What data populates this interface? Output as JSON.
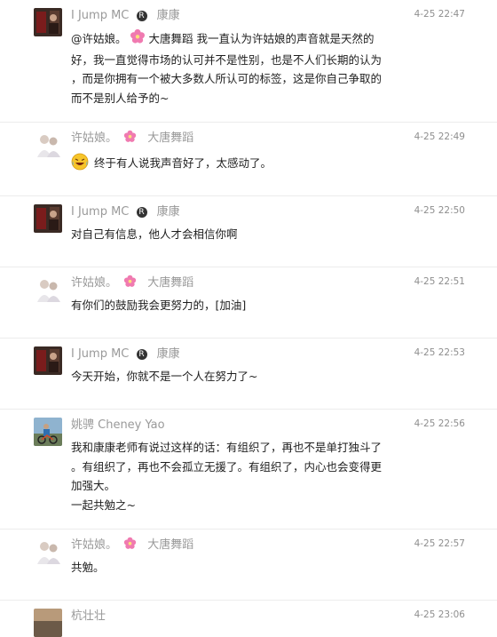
{
  "comments": [
    {
      "user": "I Jump MC",
      "badge_text": "康康",
      "time": "4-25 22:47",
      "body_prefix": "@许姑娘。",
      "body_tag": "大唐舞蹈",
      "body_rest": "我一直认为许姑娘的声音就是天然的",
      "body_lines": [
        "好，我一直觉得市场的认可并不是性别，也是不人们长期的认为",
        "，而是你拥有一个被大多数人所认可的标签，这是你自己争取的",
        "而不是别人给予的~"
      ],
      "avatar": "avatar-dark-photo"
    },
    {
      "user": "许姑娘。",
      "badge_text": "大唐舞蹈",
      "time": "4-25 22:49",
      "body": "终于有人说我声音好了，太感动了。",
      "emoji": "laughing-crying-emoji",
      "avatar": "avatar-light-figures"
    },
    {
      "user": "I Jump MC",
      "badge_text": "康康",
      "time": "4-25 22:50",
      "body": "对自己有信息，他人才会相信你啊",
      "avatar": "avatar-dark-photo"
    },
    {
      "user": "许姑娘。",
      "badge_text": "大唐舞蹈",
      "time": "4-25 22:51",
      "body": "有你们的鼓励我会更努力的，[加油]",
      "avatar": "avatar-light-figures"
    },
    {
      "user": "I Jump MC",
      "badge_text": "康康",
      "time": "4-25 22:53",
      "body": "今天开始，你就不是一个人在努力了~",
      "avatar": "avatar-dark-photo"
    },
    {
      "user": "姚骋 Cheney Yao",
      "time": "4-25 22:56",
      "body_lines": [
        "我和康康老师有说过这样的话：有组织了，再也不是单打独斗了",
        "。有组织了，再也不会孤立无援了。有组织了，内心也会变得更",
        "加强大。",
        "一起共勉之~"
      ],
      "avatar": "avatar-outdoor-photo"
    },
    {
      "user": "许姑娘。",
      "badge_text": "大唐舞蹈",
      "time": "4-25 22:57",
      "body": "共勉。",
      "avatar": "avatar-light-figures"
    },
    {
      "user": "杭壮壮",
      "time": "4-25 23:06",
      "avatar": "avatar-partial"
    }
  ],
  "colors": {
    "name_gray": "#9a9a9a",
    "text": "#1e1e1e",
    "divider": "#ececec",
    "flower_pink": "#f07ab0"
  }
}
